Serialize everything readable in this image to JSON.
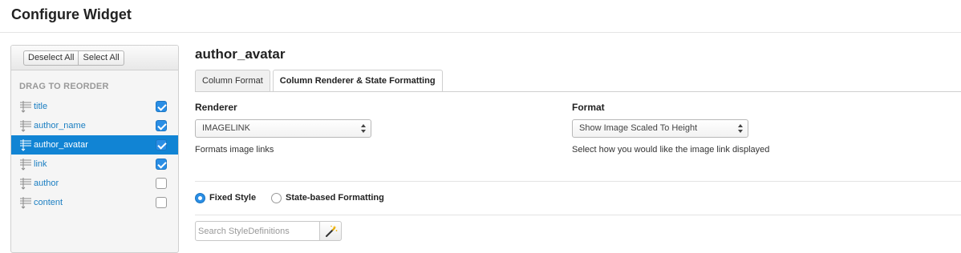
{
  "header": {
    "title": "Configure Widget"
  },
  "sidebar": {
    "deselect_all": "Deselect All",
    "select_all": "Select All",
    "drag_title": "DRAG TO REORDER",
    "fields": [
      {
        "label": "title",
        "checked": true,
        "selected": false
      },
      {
        "label": "author_name",
        "checked": true,
        "selected": false
      },
      {
        "label": "author_avatar",
        "checked": true,
        "selected": true
      },
      {
        "label": "link",
        "checked": true,
        "selected": false
      },
      {
        "label": "author",
        "checked": false,
        "selected": false
      },
      {
        "label": "content",
        "checked": false,
        "selected": false
      }
    ]
  },
  "main": {
    "title": "author_avatar",
    "tabs": [
      {
        "label": "Column Format",
        "active": false
      },
      {
        "label": "Column Renderer & State Formatting",
        "active": true
      }
    ],
    "renderer": {
      "label": "Renderer",
      "value": "IMAGELINK",
      "help": "Formats image links"
    },
    "format": {
      "label": "Format",
      "value": "Show Image Scaled To Height",
      "help": "Select how you would like the image link displayed"
    },
    "style_mode": {
      "options": [
        {
          "label": "Fixed Style",
          "selected": true
        },
        {
          "label": "State-based Formatting",
          "selected": false
        }
      ]
    },
    "search": {
      "placeholder": "Search StyleDefinitions",
      "value": ""
    }
  },
  "colors": {
    "accent": "#1184d4",
    "link": "#1a7ec2"
  },
  "icons": {
    "drag": "drag-handle-icon",
    "wand": "magic-wand-icon"
  }
}
